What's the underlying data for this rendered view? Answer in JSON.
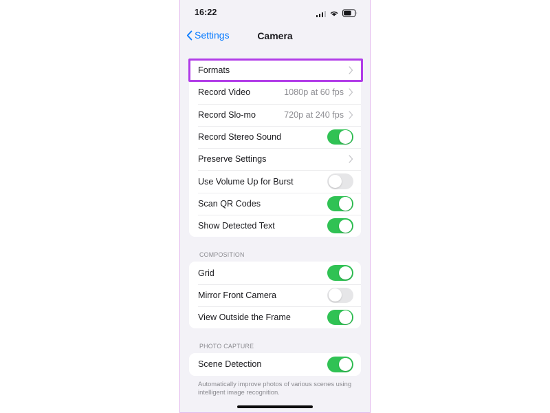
{
  "status_bar": {
    "time": "16:22",
    "cellular_icon": "signal-bars-icon",
    "wifi_icon": "wifi-icon",
    "battery_icon": "battery-icon"
  },
  "nav": {
    "back_label": "Settings",
    "back_icon": "chevron-left-icon",
    "title": "Camera"
  },
  "highlight": {
    "target": "Formats",
    "color": "#b13ce8"
  },
  "sections": [
    {
      "header": "",
      "footer": "",
      "rows": [
        {
          "label": "Formats",
          "type": "disclosure",
          "value": "",
          "highlighted": true
        },
        {
          "label": "Record Video",
          "type": "disclosure",
          "value": "1080p at 60 fps"
        },
        {
          "label": "Record Slo-mo",
          "type": "disclosure",
          "value": "720p at 240 fps"
        },
        {
          "label": "Record Stereo Sound",
          "type": "toggle",
          "on": true
        },
        {
          "label": "Preserve Settings",
          "type": "disclosure",
          "value": ""
        },
        {
          "label": "Use Volume Up for Burst",
          "type": "toggle",
          "on": false
        },
        {
          "label": "Scan QR Codes",
          "type": "toggle",
          "on": true
        },
        {
          "label": "Show Detected Text",
          "type": "toggle",
          "on": true
        }
      ]
    },
    {
      "header": "COMPOSITION",
      "footer": "",
      "rows": [
        {
          "label": "Grid",
          "type": "toggle",
          "on": true
        },
        {
          "label": "Mirror Front Camera",
          "type": "toggle",
          "on": false
        },
        {
          "label": "View Outside the Frame",
          "type": "toggle",
          "on": true
        }
      ]
    },
    {
      "header": "PHOTO CAPTURE",
      "footer": "Automatically improve photos of various scenes using intelligent image recognition.",
      "rows": [
        {
          "label": "Scene Detection",
          "type": "toggle",
          "on": true
        }
      ]
    }
  ]
}
